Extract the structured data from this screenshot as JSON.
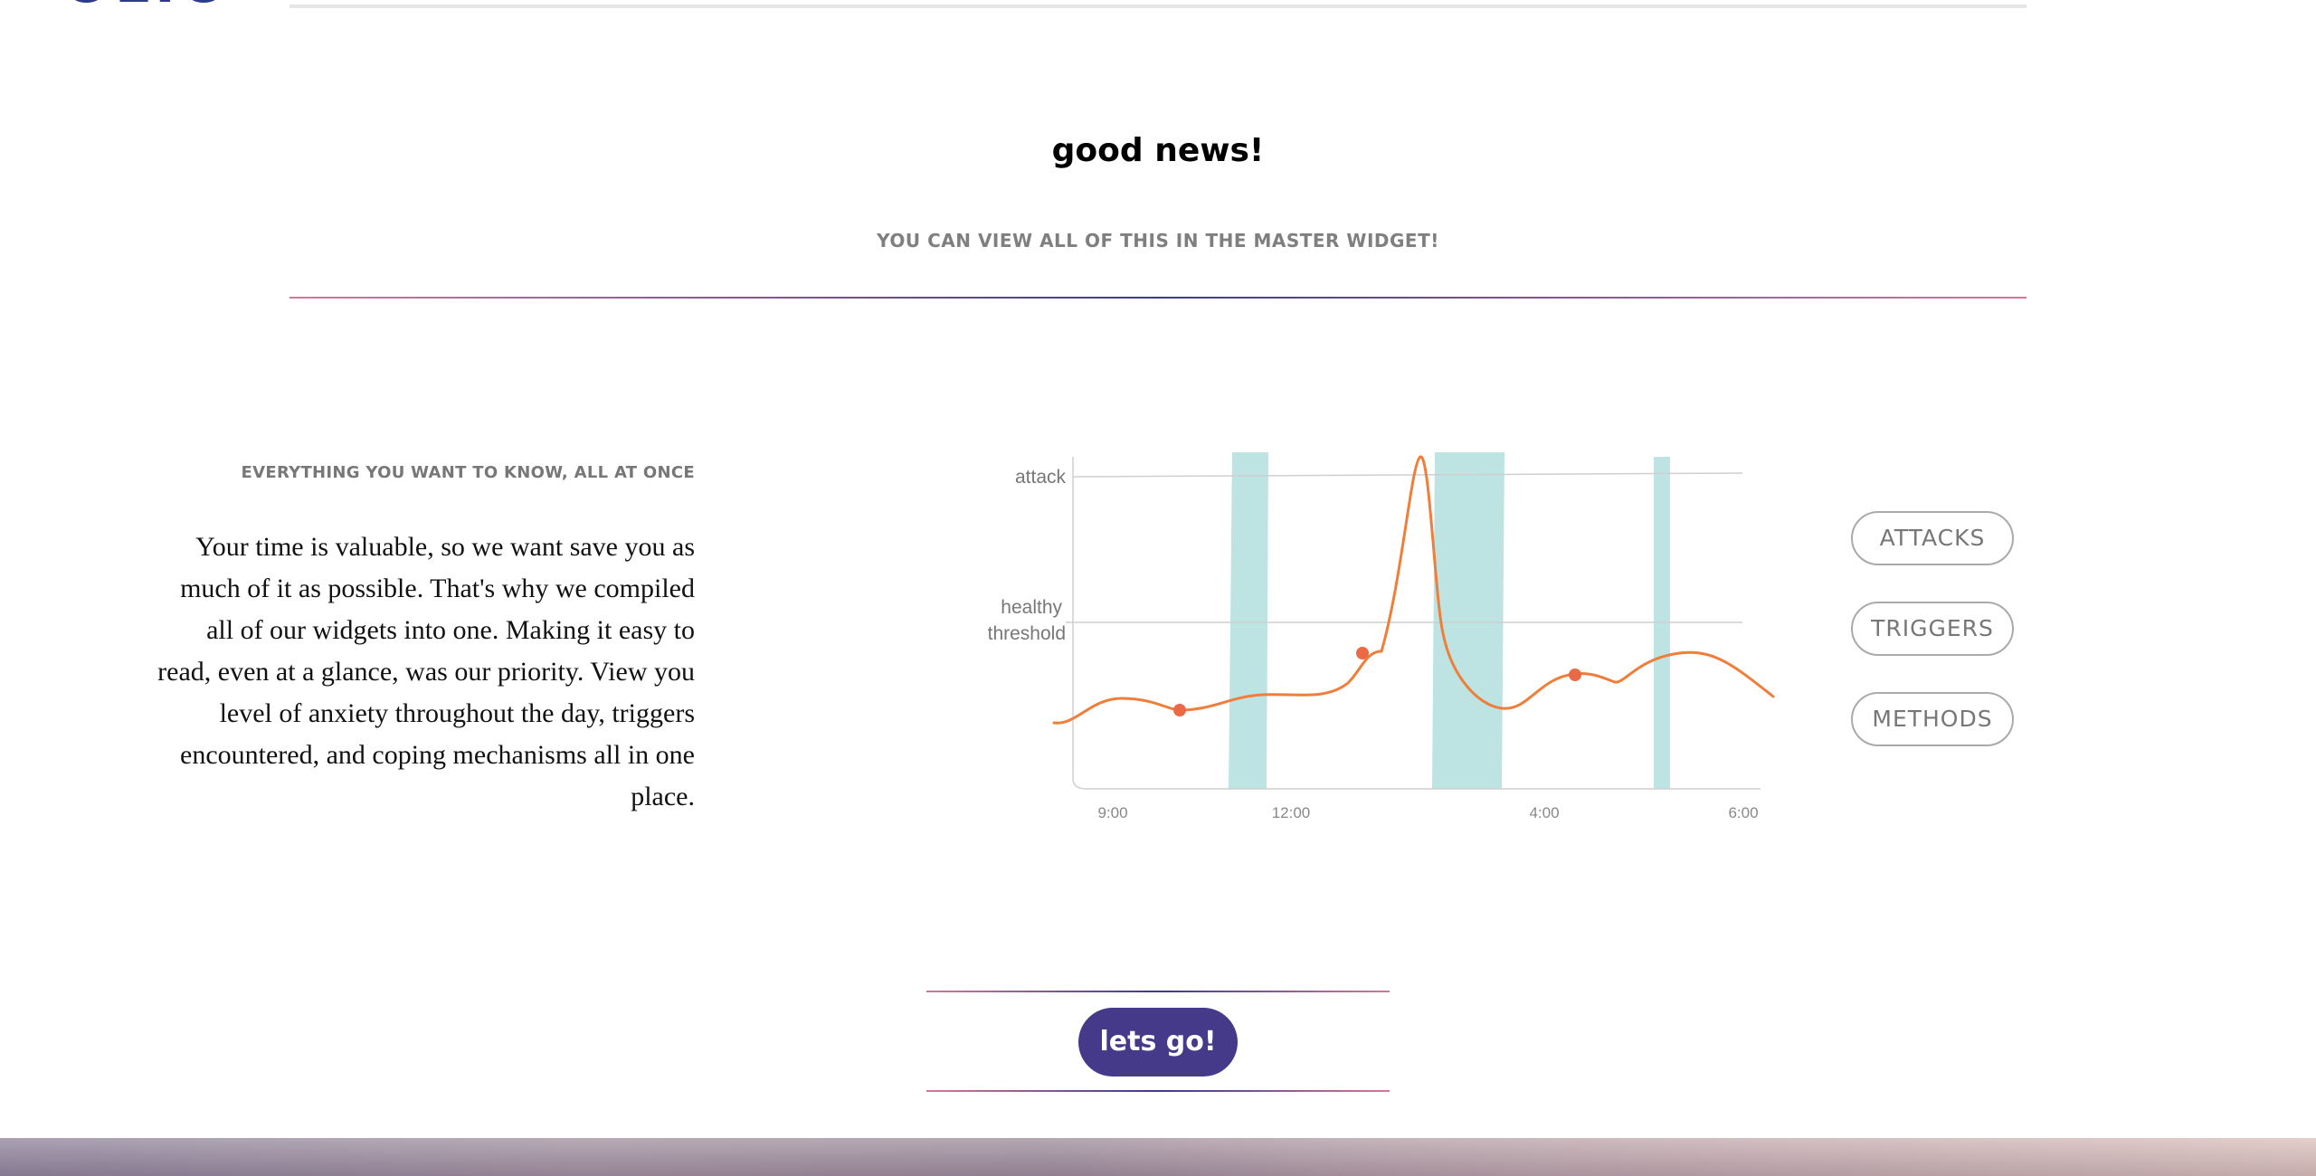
{
  "logo": {
    "text": "OLIO"
  },
  "hero": {
    "title": "good news!",
    "subtitle": "YOU CAN VIEW ALL OF THIS IN THE MASTER WIDGET!"
  },
  "feature": {
    "label": "EVERYTHING YOU WANT TO KNOW, ALL AT ONCE",
    "body": "Your time is valuable, so we want save you as much of it as possible. That's why we compiled all of our widgets into one. Making it easy to read, even at a glance, was our priority. View you level of anxiety throughout the day, triggers encountered, and coping mechanisms all in one place."
  },
  "chart_data": {
    "type": "line",
    "x_ticks": [
      "9:00",
      "12:00",
      "4:00",
      "6:00"
    ],
    "y_labels": [
      "attack",
      "healthy",
      "threshold"
    ],
    "line_color": "#ee7e3a",
    "band_color": "#bde4e2",
    "point_color": "#ea6a45",
    "grid": true
  },
  "filters": [
    {
      "label": "ATTACKS"
    },
    {
      "label": "TRIGGERS"
    },
    {
      "label": "METHODS"
    }
  ],
  "cta": {
    "label": "lets go!"
  },
  "colors": {
    "accent": "#45398a",
    "rule_pink": "#d4789a",
    "rule_navy": "#3c3a8e",
    "logo": "#2e3a8c"
  }
}
